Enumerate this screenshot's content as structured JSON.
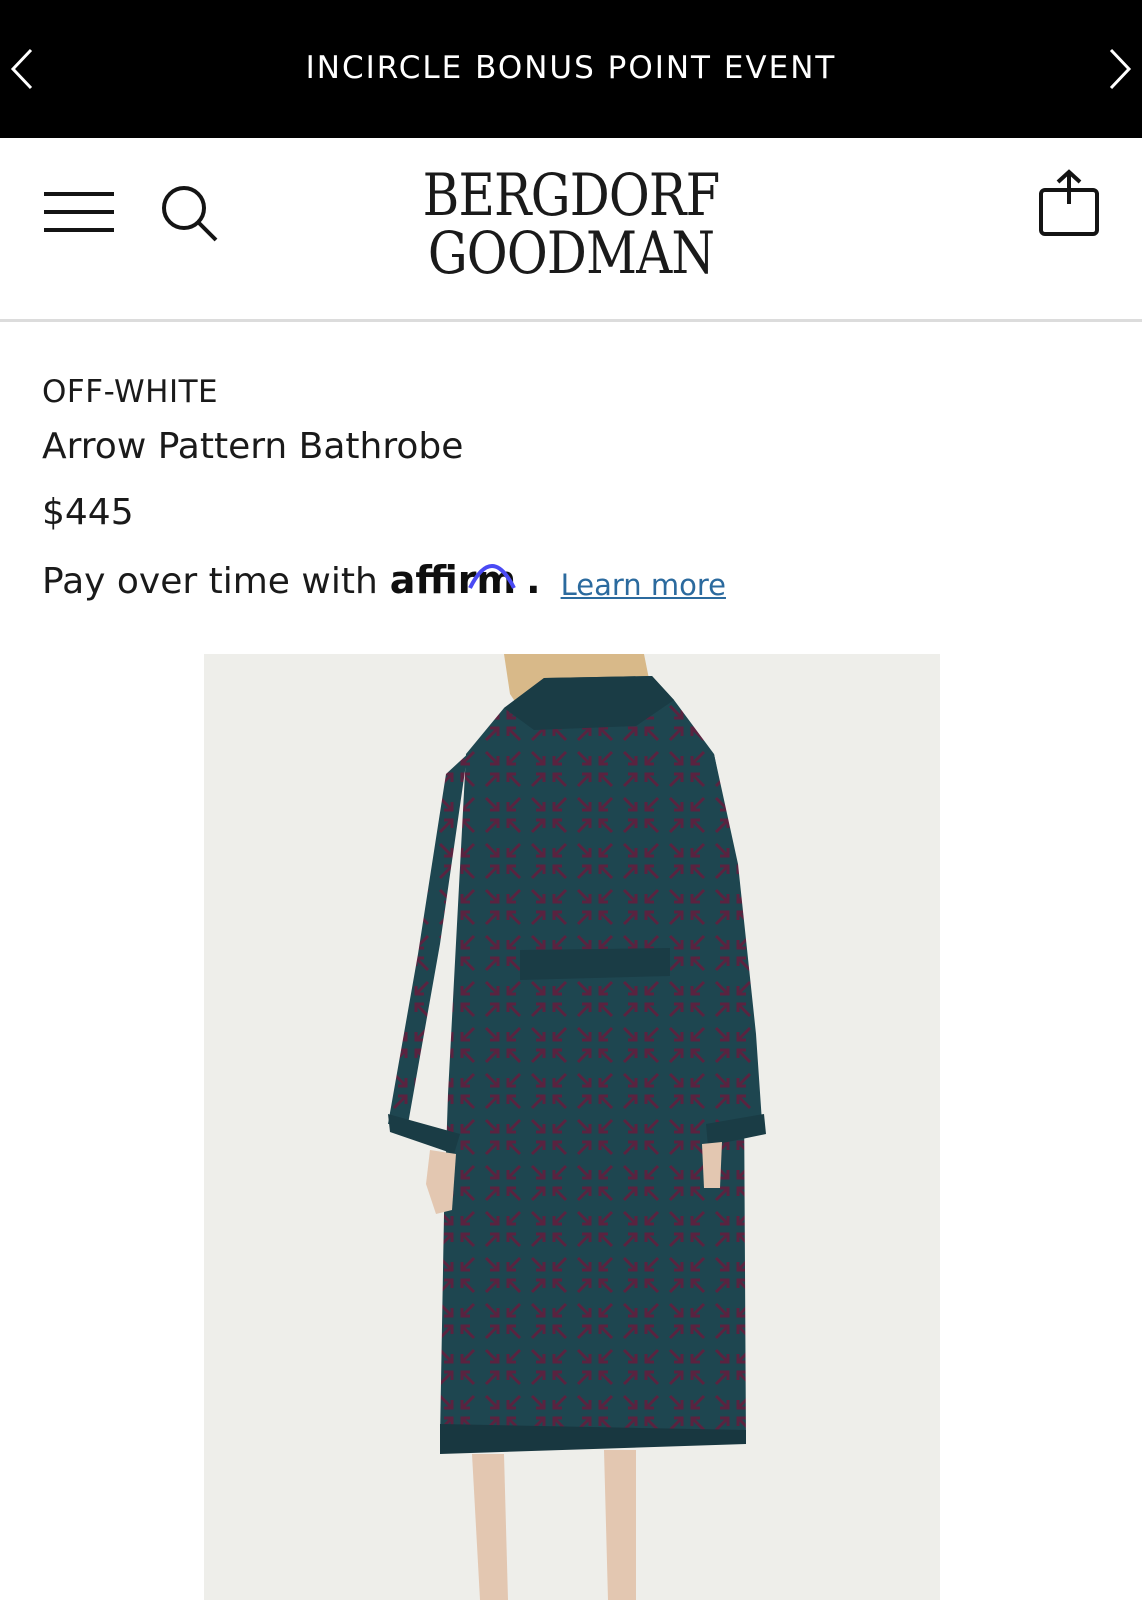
{
  "promo": {
    "text": "INCIRCLE BONUS POINT EVENT",
    "prev_icon": "chevron-left-icon",
    "next_icon": "chevron-right-icon"
  },
  "header": {
    "logo_line1": "BERGDORF",
    "logo_line2": "GOODMAN",
    "menu_icon": "hamburger-icon",
    "search_icon": "search-icon",
    "bag_icon": "shopping-bag-icon"
  },
  "product": {
    "brand": "OFF-WHITE",
    "name": "Arrow Pattern Bathrobe",
    "price": "$445",
    "pay_text": "Pay over time with",
    "affirm": "affirm",
    "affirm_period": ".",
    "learn_more": "Learn more"
  },
  "colors": {
    "banner": "#000000",
    "link": "#2b6a9e",
    "affirm_arc": "#4a4af4",
    "robe": "#1e4650",
    "robe_pattern": "#5a2340",
    "photo_bg": "#eeeeea"
  }
}
